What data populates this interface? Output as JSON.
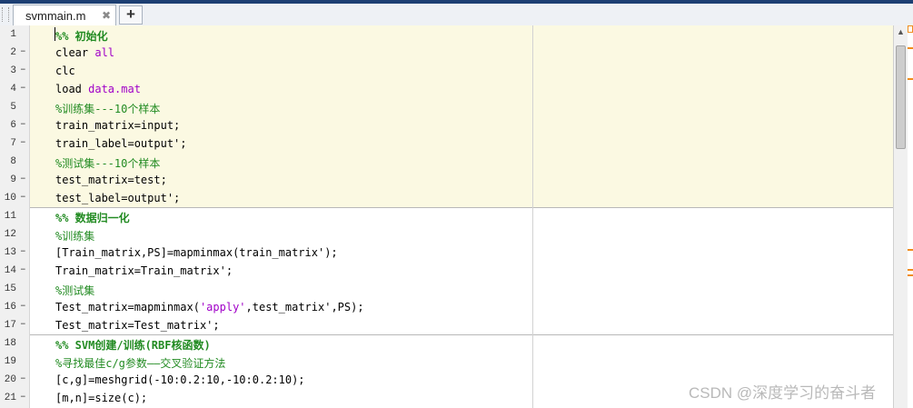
{
  "tab": {
    "filename": "svmmain.m",
    "close_glyph": "✖",
    "new_tab_glyph": "+"
  },
  "watermark": "CSDN @深度学习的奋斗者",
  "lines": [
    {
      "n": "1",
      "dash": "",
      "parts": [
        {
          "c": "cmb",
          "t": "%% 初始化"
        }
      ]
    },
    {
      "n": "2",
      "dash": "–",
      "parts": [
        {
          "c": "",
          "t": "clear "
        },
        {
          "c": "kw",
          "t": "all"
        }
      ]
    },
    {
      "n": "3",
      "dash": "–",
      "parts": [
        {
          "c": "",
          "t": "clc"
        }
      ]
    },
    {
      "n": "4",
      "dash": "–",
      "parts": [
        {
          "c": "",
          "t": "load "
        },
        {
          "c": "kw",
          "t": "data.mat"
        }
      ]
    },
    {
      "n": "5",
      "dash": "",
      "parts": [
        {
          "c": "cm",
          "t": "%训练集---10个样本"
        }
      ]
    },
    {
      "n": "6",
      "dash": "–",
      "parts": [
        {
          "c": "",
          "t": "train_matrix=input;"
        }
      ]
    },
    {
      "n": "7",
      "dash": "–",
      "parts": [
        {
          "c": "",
          "t": "train_label=output';"
        }
      ]
    },
    {
      "n": "8",
      "dash": "",
      "parts": [
        {
          "c": "cm",
          "t": "%测试集---10个样本"
        }
      ]
    },
    {
      "n": "9",
      "dash": "–",
      "parts": [
        {
          "c": "",
          "t": "test_matrix=test;"
        }
      ]
    },
    {
      "n": "10",
      "dash": "–",
      "parts": [
        {
          "c": "",
          "t": "test_label=output';"
        }
      ]
    },
    {
      "n": "11",
      "dash": "",
      "parts": [
        {
          "c": "cmb",
          "t": "%% 数据归一化"
        }
      ]
    },
    {
      "n": "12",
      "dash": "",
      "parts": [
        {
          "c": "cm",
          "t": "%训练集"
        }
      ]
    },
    {
      "n": "13",
      "dash": "–",
      "parts": [
        {
          "c": "",
          "t": "[Train_matrix,PS]=mapminmax(train_matrix');"
        }
      ]
    },
    {
      "n": "14",
      "dash": "–",
      "parts": [
        {
          "c": "",
          "t": "Train_matrix=Train_matrix';"
        }
      ]
    },
    {
      "n": "15",
      "dash": "",
      "parts": [
        {
          "c": "cm",
          "t": "%测试集"
        }
      ]
    },
    {
      "n": "16",
      "dash": "–",
      "parts": [
        {
          "c": "",
          "t": "Test_matrix=mapminmax("
        },
        {
          "c": "str",
          "t": "'apply'"
        },
        {
          "c": "",
          "t": ",test_matrix',PS);"
        }
      ]
    },
    {
      "n": "17",
      "dash": "–",
      "parts": [
        {
          "c": "",
          "t": "Test_matrix=Test_matrix';"
        }
      ]
    },
    {
      "n": "18",
      "dash": "",
      "parts": [
        {
          "c": "cmb",
          "t": "%% SVM创建/训练(RBF核函数)"
        }
      ]
    },
    {
      "n": "19",
      "dash": "",
      "parts": [
        {
          "c": "cm",
          "t": "%寻找最佳c/g参数——交叉验证方法"
        }
      ]
    },
    {
      "n": "20",
      "dash": "–",
      "parts": [
        {
          "c": "",
          "t": "[c,g]=meshgrid(-10:0.2:10,-10:0.2:10);"
        }
      ]
    },
    {
      "n": "21",
      "dash": "–",
      "parts": [
        {
          "c": "",
          "t": "[m,n]=size(c);"
        }
      ]
    }
  ],
  "colors": {
    "cell_highlight": "#fbf9e2",
    "comment": "#228b22",
    "keyword": "#a000c8",
    "marker": "#f08c1c"
  }
}
